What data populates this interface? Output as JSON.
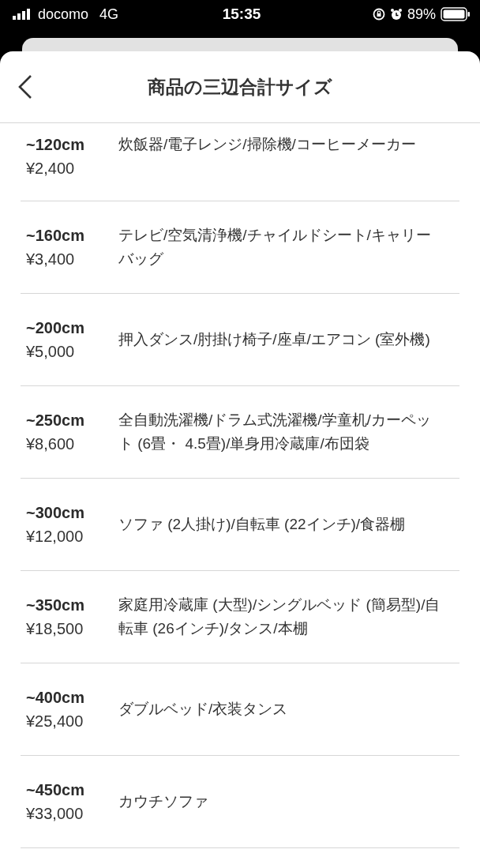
{
  "status_bar": {
    "carrier": "docomo",
    "network": "4G",
    "time": "15:35",
    "battery": "89%"
  },
  "header": {
    "title": "商品の三辺合計サイズ"
  },
  "sizes": [
    {
      "size": "~120cm",
      "price": "¥2,400",
      "items": "炊飯器/電子レンジ/掃除機/コーヒーメーカー"
    },
    {
      "size": "~160cm",
      "price": "¥3,400",
      "items": "テレビ/空気清浄機/チャイルドシート/キャリーバッグ"
    },
    {
      "size": "~200cm",
      "price": "¥5,000",
      "items": "押入ダンス/肘掛け椅子/座卓/エアコン (室外機)"
    },
    {
      "size": "~250cm",
      "price": "¥8,600",
      "items": "全自動洗濯機/ドラム式洗濯機/学童机/カーペット (6畳・ 4.5畳)/単身用冷蔵庫/布団袋"
    },
    {
      "size": "~300cm",
      "price": "¥12,000",
      "items": "ソファ (2人掛け)/自転車 (22インチ)/食器棚"
    },
    {
      "size": "~350cm",
      "price": "¥18,500",
      "items": "家庭用冷蔵庫 (大型)/シングルベッド (簡易型)/自転車 (26インチ)/タンス/本棚"
    },
    {
      "size": "~400cm",
      "price": "¥25,400",
      "items": "ダブルベッド/衣装タンス"
    },
    {
      "size": "~450cm",
      "price": "¥33,000",
      "items": "カウチソファ"
    }
  ]
}
